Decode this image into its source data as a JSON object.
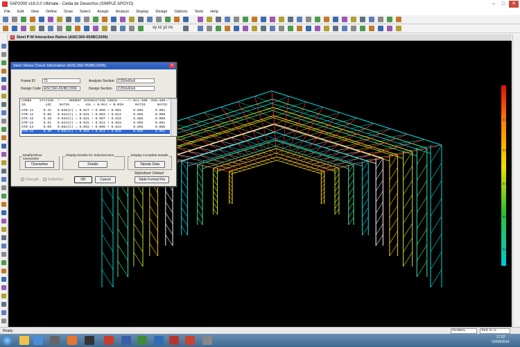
{
  "window": {
    "title": "SAP2000 v16.0.0 Ultimate  - Celda de Desechos (SIMPLE APOYO)",
    "minimize": "–",
    "maximize": "□",
    "close": "✕"
  },
  "menu": [
    "File",
    "Edit",
    "View",
    "Define",
    "Draw",
    "Select",
    "Assign",
    "Analyze",
    "Display",
    "Design",
    "Options",
    "Tools",
    "Help"
  ],
  "toolbar_row2_text": "xy xz yz nv",
  "document_tab": {
    "close": "x",
    "title": "Steel P-M Interaction Ratios  (AISC360-05/IBC2006)"
  },
  "dialog": {
    "title": "Steel Stress Check Information  (AISC360-05/IBC2006)",
    "close": "x",
    "frame_id_label": "Frame ID",
    "frame_id_value": "73",
    "design_code_label": "Design Code",
    "design_code_value": "AISC360-05/IBC2006",
    "analysis_section_label": "Analysis Section",
    "analysis_section_value": "C250x60x6",
    "design_section_label": "Design Section",
    "design_section_value": "C250x60x6",
    "table_header1": "COMBO    STATION  /-----MOMENT INTERACTION CHECK-----//-MAJ-SHR--MIN-SHR-/",
    "table_header2": "ID          LOC    RATIO    =   AXL + B-MAJ + B-MIN      RATIO      RATIO",
    "rows": [
      "STR-11     0.41   0.036(C) = 0.027 + 0.009 + 0.001      0.002      0.001",
      "STR-12     0.05   0.044(C) = 0.031 + 0.003 + 0.012      0.002      0.000",
      "STR-12     0.36   0.045(C) = 0.031 + 0.007 + 0.010      0.002      0.000",
      "STR-12     0.61   0.044(C) = 0.031 + 0.011 + 0.003      0.002      0.001",
      "STR-23     0.09   0.081(C) = 0.093 + 0.009 + 0.023      0.004      0.000",
      "STR-23     0.30   0.081(C) = 0.093 + 0.012 + 0.016      0.004      0.001"
    ],
    "group1_title": "Modify/Show Overwrites",
    "overwrites_button": "Overwrites",
    "group2_title": "Display Details for Selected Item",
    "details_button": "Details",
    "group3_title": "Display Complete Details",
    "tabular_button": "Tabular Data",
    "stylesheet_text": "Stylesheet: Default",
    "table_format_button": "Table Format File",
    "radio_strength": "Strength",
    "radio_deflection": "Deflection",
    "ok_button": "OK",
    "cancel_button": "Cancel"
  },
  "legend": {
    "labels": [
      "1.00",
      "0.90",
      "0.70",
      "0.50",
      "0.00"
    ],
    "colors": [
      "#ff0000",
      "#ff8c00",
      "#ffff00",
      "#00ff00",
      "#00ffff"
    ]
  },
  "status": {
    "ready": "Ready",
    "coord_system": "GLOBAL",
    "units": "Tonf, m, C"
  },
  "taskbar": {
    "time": "17:22",
    "date": "02/09/2014"
  }
}
